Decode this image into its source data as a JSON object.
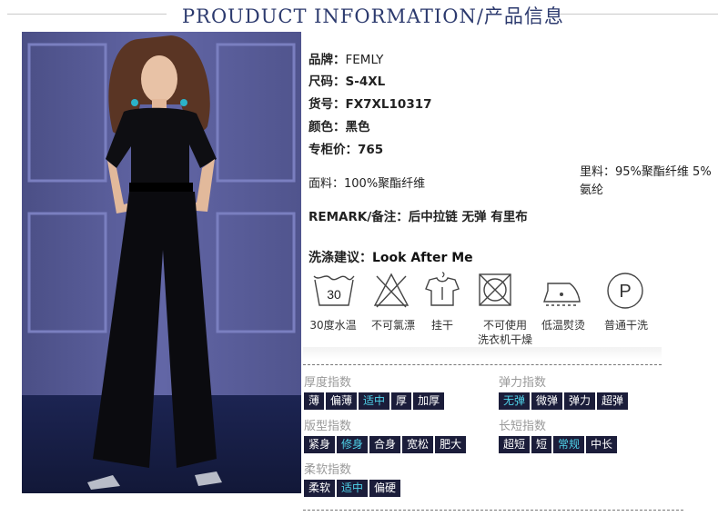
{
  "header": {
    "title": "PROUDUCT INFORMATION/产品信息"
  },
  "product": {
    "brand_label": "品牌：",
    "brand": "FEMLY",
    "size_label": "尺码：",
    "size": "S-4XL",
    "sku_label": "货号：",
    "sku": "FX7XL10317",
    "color_label": "颜色：",
    "color": "黑色",
    "price_label": "专柜价：",
    "price": "765",
    "fabric_label": "面料：",
    "fabric": "100%聚酯纤维",
    "lining_label": "里料：",
    "lining": "95%聚酯纤维 5%氨纶",
    "remark_label": "REMARK/备注：",
    "remark": "后中拉链 无弹 有里布",
    "wash_label": "洗涤建议：",
    "wash_value": "Look After Me"
  },
  "care": [
    {
      "icon": "wash-30-icon",
      "number": "30",
      "label": "30度水温"
    },
    {
      "icon": "no-bleach-icon",
      "label": "不可氯漂"
    },
    {
      "icon": "hang-dry-icon",
      "label": "挂干"
    },
    {
      "icon": "no-tumble-dry-icon",
      "label_line1": "不可使用",
      "label_line2": "洗衣机干燥"
    },
    {
      "icon": "low-iron-icon",
      "label": "低温熨烫"
    },
    {
      "icon": "dry-clean-icon",
      "letter": "P",
      "label": "普通干洗"
    }
  ],
  "indices": {
    "thickness": {
      "title": "厚度指数",
      "options": [
        "薄",
        "偏薄",
        "适中",
        "厚",
        "加厚"
      ],
      "selected": "适中"
    },
    "elasticity": {
      "title": "弹力指数",
      "options": [
        "无弹",
        "微弹",
        "弹力",
        "超弹"
      ],
      "selected": "无弹"
    },
    "fit": {
      "title": "版型指数",
      "options": [
        "紧身",
        "修身",
        "合身",
        "宽松",
        "肥大"
      ],
      "selected": "修身"
    },
    "length": {
      "title": "长短指数",
      "options": [
        "超短",
        "短",
        "常规",
        "中长"
      ],
      "selected": "常规"
    },
    "softness": {
      "title": "柔软指数",
      "options": [
        "柔软",
        "适中",
        "偏硬"
      ],
      "selected": "适中"
    }
  },
  "colors": {
    "accent": "#4fd3ea",
    "chip_bg": "#1b1d3a",
    "title": "#2c3a6e"
  }
}
